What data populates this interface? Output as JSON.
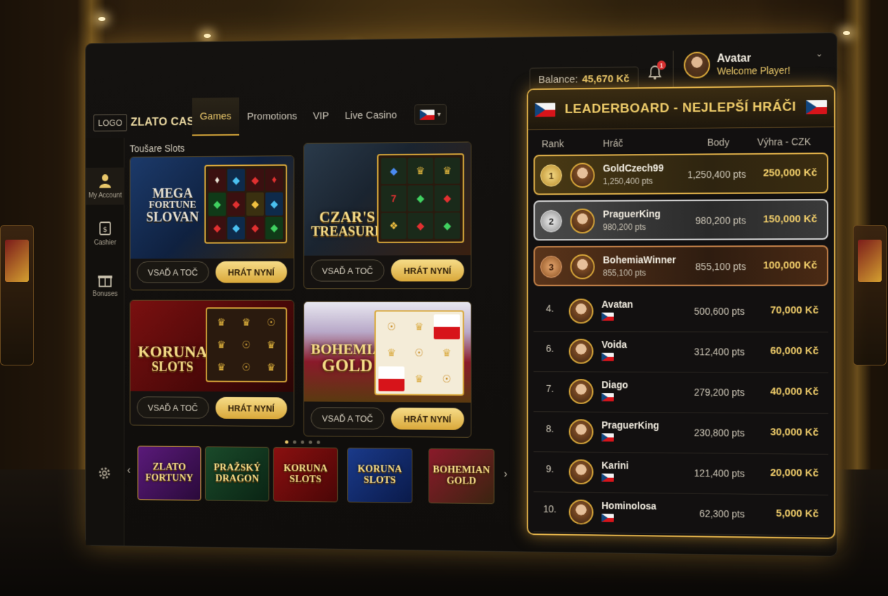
{
  "topbar": {
    "logo_tag": "LOGO",
    "brand": "ZLATO CASINO",
    "nav": [
      "Games",
      "Promotions",
      "VIP",
      "Live Casino"
    ],
    "balance_label": "Balance:",
    "balance_value": "45,670 Kč",
    "notification_count": "1",
    "user_name": "Avatar",
    "user_greeting": "Welcome Player!"
  },
  "sidebar": {
    "items": [
      "My Account",
      "Cashier",
      "Bonuses"
    ]
  },
  "content": {
    "section_title": "Toušare Slots",
    "games": [
      {
        "title_lines": [
          "MEGA",
          "FORTUNE",
          "SLOVAN"
        ],
        "reel_label": "ZLATO FORTUNY",
        "btn_secondary": "VSAĎ A TOČ",
        "btn_primary": "HRÁT NYNÍ"
      },
      {
        "title_lines": [
          "CZAR'S",
          "TREASURE"
        ],
        "btn_secondary": "VSAĎ A TOČ",
        "btn_primary": "HRÁT NYNÍ"
      },
      {
        "title_lines": [
          "KORUNA",
          "SLOTS"
        ],
        "btn_secondary": "VSAĎ A TOČ",
        "btn_primary": "HRÁT NYNÍ"
      },
      {
        "title_lines": [
          "BOHEMIAN",
          "GOLD"
        ],
        "btn_secondary": "VSAĎ A TOČ",
        "btn_primary": "HRÁT NYNÍ"
      }
    ],
    "carousel_page": 1,
    "carousel_pages": 5,
    "thumbnails": [
      {
        "title": "ZLATO FORTUNY"
      },
      {
        "title": "PRAŽSKÝ DRAGON"
      },
      {
        "title": "KORUNA SLOTS"
      },
      {
        "title": "KORUNA SLOTS"
      },
      {
        "title": "BOHEMIAN GOLD"
      }
    ]
  },
  "leaderboard": {
    "title": "LEADERBOARD - NEJLEPŠÍ HRÁČI",
    "columns": {
      "rank": "Rank",
      "player": "Hráč",
      "points": "Body",
      "win": "Výhra - CZK"
    },
    "rows": [
      {
        "rank": "1",
        "name": "GoldCzech99",
        "sub": "1,250,400 pts",
        "points": "1,250,400 pts",
        "win": "250,000 Kč",
        "tier": "gold"
      },
      {
        "rank": "2",
        "name": "PraguerKing",
        "sub": "980,200 pts",
        "points": "980,200 pts",
        "win": "150,000 Kč",
        "tier": "silver"
      },
      {
        "rank": "3",
        "name": "BohemiaWinner",
        "sub": "855,100 pts",
        "points": "855,100 pts",
        "win": "100,000 Kč",
        "tier": "bronze"
      },
      {
        "rank": "4.",
        "name": "Avatan",
        "points": "500,600 pts",
        "win": "70,000 Kč"
      },
      {
        "rank": "6.",
        "name": "Voida",
        "points": "312,400 pts",
        "win": "60,000 Kč"
      },
      {
        "rank": "7.",
        "name": "Diago",
        "points": "279,200 pts",
        "win": "40,000 Kč"
      },
      {
        "rank": "8.",
        "name": "PraguerKing",
        "points": "230,800 pts",
        "win": "30,000 Kč"
      },
      {
        "rank": "9.",
        "name": "Karini",
        "points": "121,400 pts",
        "win": "20,000 Kč"
      },
      {
        "rank": "10.",
        "name": "Hominolosa",
        "points": "62,300 pts",
        "win": "5,000 Kč"
      }
    ]
  },
  "colors": {
    "gold": "#e9c76a",
    "panel": "#121010",
    "accent_border": "#e2b24a"
  },
  "icons": [
    "user-icon",
    "cashier-icon",
    "gift-icon",
    "gear-icon",
    "bell-icon",
    "chevron-down-icon",
    "chevron-left-icon",
    "chevron-right-icon"
  ]
}
